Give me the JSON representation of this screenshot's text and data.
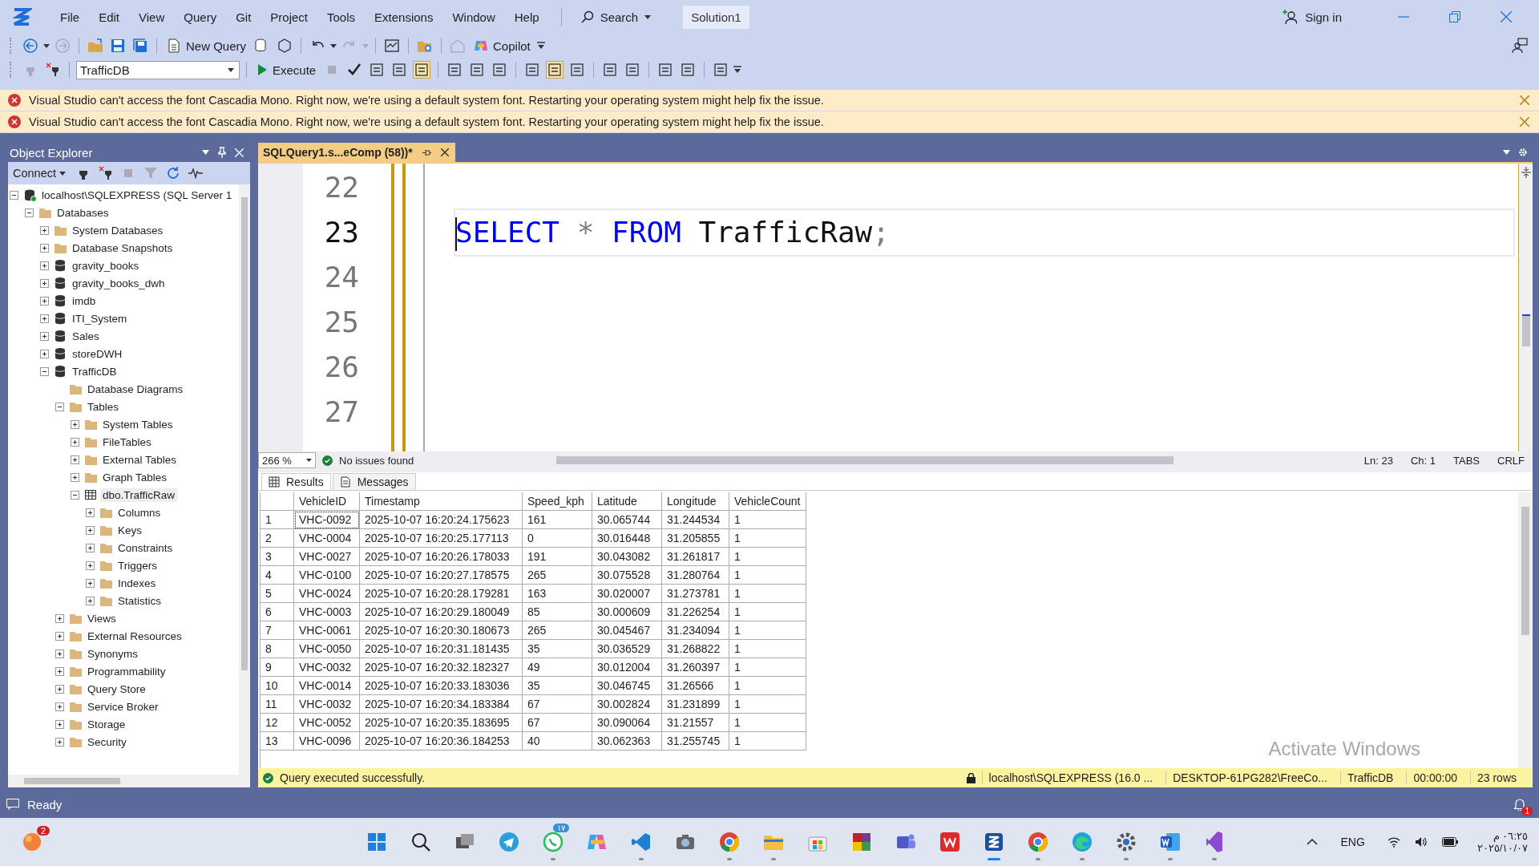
{
  "menu": [
    "File",
    "Edit",
    "View",
    "Query",
    "Git",
    "Project",
    "Tools",
    "Extensions",
    "Window",
    "Help"
  ],
  "search": "Search",
  "solution": "Solution1",
  "sign_in": "Sign in",
  "toolbar": {
    "new_query": "New Query",
    "copilot": "Copilot",
    "database": "TrafficDB",
    "execute": "Execute"
  },
  "notifications": [
    {
      "message": "Visual Studio can't access the font Cascadia Mono. Right now, we're using a default system font. Restarting your operating system might help fix the issue."
    },
    {
      "message": "Visual Studio can't access the font Cascadia Mono. Right now, we're using a default system font. Restarting your operating system might help fix the issue."
    }
  ],
  "object_explorer": {
    "title": "Object Explorer",
    "connect": "Connect",
    "tree": [
      {
        "label": "localhost\\SQLEXPRESS (SQL Server 1",
        "kind": "server",
        "has_expander": true,
        "expanded": true,
        "selected": false,
        "children": [
          {
            "label": "Databases",
            "kind": "folder",
            "has_expander": true,
            "expanded": true,
            "selected": false,
            "children": [
              {
                "label": "System Databases",
                "kind": "folder",
                "has_expander": true,
                "expanded": false,
                "selected": false
              },
              {
                "label": "Database Snapshots",
                "kind": "folder",
                "has_expander": true,
                "expanded": false,
                "selected": false
              },
              {
                "label": "gravity_books",
                "kind": "database",
                "has_expander": true,
                "expanded": false,
                "selected": false
              },
              {
                "label": "gravity_books_dwh",
                "kind": "database",
                "has_expander": true,
                "expanded": false,
                "selected": false
              },
              {
                "label": "imdb",
                "kind": "database",
                "has_expander": true,
                "expanded": false,
                "selected": false
              },
              {
                "label": "ITI_System",
                "kind": "database",
                "has_expander": true,
                "expanded": false,
                "selected": false
              },
              {
                "label": "Sales",
                "kind": "database",
                "has_expander": true,
                "expanded": false,
                "selected": false
              },
              {
                "label": "storeDWH",
                "kind": "database",
                "has_expander": true,
                "expanded": false,
                "selected": false
              },
              {
                "label": "TrafficDB",
                "kind": "database",
                "has_expander": true,
                "expanded": true,
                "selected": false,
                "children": [
                  {
                    "label": "Database Diagrams",
                    "kind": "folder",
                    "has_expander": false,
                    "selected": false
                  },
                  {
                    "label": "Tables",
                    "kind": "folder",
                    "has_expander": true,
                    "expanded": true,
                    "selected": false,
                    "children": [
                      {
                        "label": "System Tables",
                        "kind": "folder",
                        "has_expander": true,
                        "expanded": false,
                        "selected": false
                      },
                      {
                        "label": "FileTables",
                        "kind": "folder",
                        "has_expander": true,
                        "expanded": false,
                        "selected": false
                      },
                      {
                        "label": "External Tables",
                        "kind": "folder",
                        "has_expander": true,
                        "expanded": false,
                        "selected": false
                      },
                      {
                        "label": "Graph Tables",
                        "kind": "folder",
                        "has_expander": true,
                        "expanded": false,
                        "selected": false
                      },
                      {
                        "label": "dbo.TrafficRaw",
                        "kind": "table",
                        "has_expander": true,
                        "expanded": true,
                        "selected": true,
                        "children": [
                          {
                            "label": "Columns",
                            "kind": "folder",
                            "has_expander": true,
                            "expanded": false,
                            "selected": false
                          },
                          {
                            "label": "Keys",
                            "kind": "folder",
                            "has_expander": true,
                            "expanded": false,
                            "selected": false
                          },
                          {
                            "label": "Constraints",
                            "kind": "folder",
                            "has_expander": true,
                            "expanded": false,
                            "selected": false
                          },
                          {
                            "label": "Triggers",
                            "kind": "folder",
                            "has_expander": true,
                            "expanded": false,
                            "selected": false
                          },
                          {
                            "label": "Indexes",
                            "kind": "folder",
                            "has_expander": true,
                            "expanded": false,
                            "selected": false
                          },
                          {
                            "label": "Statistics",
                            "kind": "folder",
                            "has_expander": true,
                            "expanded": false,
                            "selected": false
                          }
                        ]
                      }
                    ]
                  },
                  {
                    "label": "Views",
                    "kind": "folder",
                    "has_expander": true,
                    "expanded": false,
                    "selected": false
                  },
                  {
                    "label": "External Resources",
                    "kind": "folder",
                    "has_expander": true,
                    "expanded": false,
                    "selected": false
                  },
                  {
                    "label": "Synonyms",
                    "kind": "folder",
                    "has_expander": true,
                    "expanded": false,
                    "selected": false
                  },
                  {
                    "label": "Programmability",
                    "kind": "folder",
                    "has_expander": true,
                    "expanded": false,
                    "selected": false
                  },
                  {
                    "label": "Query Store",
                    "kind": "folder",
                    "has_expander": true,
                    "expanded": false,
                    "selected": false
                  },
                  {
                    "label": "Service Broker",
                    "kind": "folder",
                    "has_expander": true,
                    "expanded": false,
                    "selected": false
                  },
                  {
                    "label": "Storage",
                    "kind": "folder",
                    "has_expander": true,
                    "expanded": false,
                    "selected": false
                  },
                  {
                    "label": "Security",
                    "kind": "folder",
                    "has_expander": true,
                    "expanded": false,
                    "selected": false
                  }
                ]
              }
            ]
          }
        ]
      }
    ]
  },
  "editor": {
    "tab": "SQLQuery1.s...eComp (58))*",
    "lines": [
      {
        "number": "22",
        "current": false
      },
      {
        "number": "23",
        "current": true,
        "tokens": [
          {
            "kind": "keyword",
            "text": "SELECT"
          },
          {
            "kind": "operator",
            "text": "*"
          },
          {
            "kind": "keyword",
            "text": "FROM"
          },
          {
            "kind": "identifier",
            "text": "TrafficRaw"
          },
          {
            "kind": "punctuation",
            "text": ";"
          }
        ]
      },
      {
        "number": "24",
        "current": false
      },
      {
        "number": "25",
        "current": false
      },
      {
        "number": "26",
        "current": false
      },
      {
        "number": "27",
        "current": false
      }
    ],
    "zoom": "266 %",
    "issues": "No issues found",
    "ln": "Ln: 23",
    "ch": "Ch: 1",
    "indent": "TABS",
    "eol": "CRLF"
  },
  "results": {
    "tabs": [
      {
        "label": "Results",
        "kind": "grid",
        "selected": true
      },
      {
        "label": "Messages",
        "kind": "messages",
        "selected": false
      }
    ],
    "columns": [
      "VehicleID",
      "Timestamp",
      "Speed_kph",
      "Latitude",
      "Longitude",
      "VehicleCount"
    ],
    "rows": [
      {
        "number": "1",
        "focused": true,
        "cells": [
          "VHC-0092",
          "2025-10-07 16:20:24.175623",
          "161",
          "30.065744",
          "31.244534",
          "1"
        ]
      },
      {
        "number": "2",
        "focused": false,
        "cells": [
          "VHC-0004",
          "2025-10-07 16:20:25.177113",
          "0",
          "30.016448",
          "31.205855",
          "1"
        ]
      },
      {
        "number": "3",
        "focused": false,
        "cells": [
          "VHC-0027",
          "2025-10-07 16:20:26.178033",
          "191",
          "30.043082",
          "31.261817",
          "1"
        ]
      },
      {
        "number": "4",
        "focused": false,
        "cells": [
          "VHC-0100",
          "2025-10-07 16:20:27.178575",
          "265",
          "30.075528",
          "31.280764",
          "1"
        ]
      },
      {
        "number": "5",
        "focused": false,
        "cells": [
          "VHC-0024",
          "2025-10-07 16:20:28.179281",
          "163",
          "30.020007",
          "31.273781",
          "1"
        ]
      },
      {
        "number": "6",
        "focused": false,
        "cells": [
          "VHC-0003",
          "2025-10-07 16:20:29.180049",
          "85",
          "30.000609",
          "31.226254",
          "1"
        ]
      },
      {
        "number": "7",
        "focused": false,
        "cells": [
          "VHC-0061",
          "2025-10-07 16:20:30.180673",
          "265",
          "30.045467",
          "31.234094",
          "1"
        ]
      },
      {
        "number": "8",
        "focused": false,
        "cells": [
          "VHC-0050",
          "2025-10-07 16:20:31.181435",
          "35",
          "30.036529",
          "31.268822",
          "1"
        ]
      },
      {
        "number": "9",
        "focused": false,
        "cells": [
          "VHC-0032",
          "2025-10-07 16:20:32.182327",
          "49",
          "30.012004",
          "31.260397",
          "1"
        ]
      },
      {
        "number": "10",
        "focused": false,
        "cells": [
          "VHC-0014",
          "2025-10-07 16:20:33.183036",
          "35",
          "30.046745",
          "31.26566",
          "1"
        ]
      },
      {
        "number": "11",
        "focused": false,
        "cells": [
          "VHC-0032",
          "2025-10-07 16:20:34.183384",
          "67",
          "30.002824",
          "31.231899",
          "1"
        ]
      },
      {
        "number": "12",
        "focused": false,
        "cells": [
          "VHC-0052",
          "2025-10-07 16:20:35.183695",
          "67",
          "30.090064",
          "31.21557",
          "1"
        ]
      },
      {
        "number": "13",
        "focused": false,
        "cells": [
          "VHC-0096",
          "2025-10-07 16:20:36.184253",
          "40",
          "30.062363",
          "31.255745",
          "1"
        ]
      }
    ]
  },
  "activation_notice": "Activate Windows",
  "query_status": {
    "message": "Query executed successfully.",
    "server": "localhost\\SQLEXPRESS (16.0 ...",
    "user": "DESKTOP-61PG282\\FreeCo...",
    "database": "TrafficDB",
    "elapsed": "00:00:00",
    "rows": "23 rows"
  },
  "status_bar": {
    "text": "Ready",
    "notification_count": "1"
  },
  "taskbar": {
    "apps": [
      {
        "kind": "start",
        "running": false,
        "active": false
      },
      {
        "kind": "search",
        "running": false,
        "active": false
      },
      {
        "kind": "task-view",
        "running": false,
        "active": false
      },
      {
        "kind": "telegram",
        "running": false,
        "active": false
      },
      {
        "kind": "whatsapp",
        "running": true,
        "active": false,
        "badge": "١٧"
      },
      {
        "kind": "copilot",
        "running": false,
        "active": false
      },
      {
        "kind": "vscode",
        "running": true,
        "active": false
      },
      {
        "kind": "camera",
        "running": false,
        "active": false
      },
      {
        "kind": "chrome",
        "running": true,
        "active": false
      },
      {
        "kind": "files",
        "running": true,
        "active": false
      },
      {
        "kind": "store",
        "running": false,
        "active": false
      },
      {
        "kind": "tiles",
        "running": false,
        "active": false
      },
      {
        "kind": "teams",
        "running": false,
        "active": false
      },
      {
        "kind": "wps",
        "running": false,
        "active": false
      },
      {
        "kind": "ssms",
        "running": true,
        "active": true
      },
      {
        "kind": "chrome",
        "running": true,
        "active": false
      },
      {
        "kind": "edge",
        "running": true,
        "active": false
      },
      {
        "kind": "settings",
        "running": true,
        "active": false
      },
      {
        "kind": "word",
        "running": true,
        "active": false
      },
      {
        "kind": "vs",
        "running": true,
        "active": false
      }
    ],
    "corner_badge": "2",
    "language": "ENG",
    "time": "٠٦:٢٥ م",
    "date": "٢٠٢٥/١٠/٠٧"
  }
}
